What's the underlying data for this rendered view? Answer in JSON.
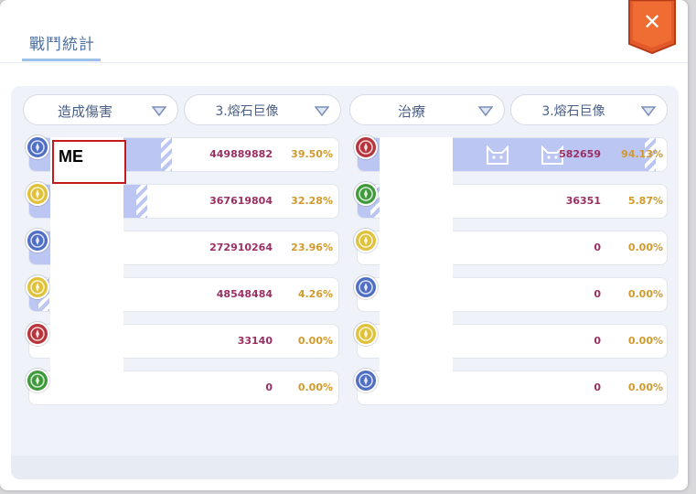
{
  "window": {
    "title": "戰鬥統計"
  },
  "close_button": {
    "symbol": "✕"
  },
  "left": {
    "metric_dropdown": "造成傷害",
    "target_dropdown": "3.熔石巨像",
    "rows": [
      {
        "color": "blue",
        "value": "449889882",
        "percent": "39.50%",
        "fraction": 0.395
      },
      {
        "color": "yellow",
        "value": "367619804",
        "percent": "32.28%",
        "fraction": 0.3228
      },
      {
        "color": "blue",
        "value": "272910264",
        "percent": "23.96%",
        "fraction": 0.2396
      },
      {
        "color": "yellow",
        "value": "48548484",
        "percent": "4.26%",
        "fraction": 0.0426
      },
      {
        "color": "red",
        "value": "33140",
        "percent": "0.00%",
        "fraction": 0
      },
      {
        "color": "green",
        "value": "0",
        "percent": "0.00%",
        "fraction": 0
      }
    ]
  },
  "right": {
    "metric_dropdown": "治療",
    "target_dropdown": "3.熔石巨像",
    "rows": [
      {
        "color": "red",
        "value": "582659",
        "percent": "94.13%",
        "fraction": 0.9413
      },
      {
        "color": "green",
        "value": "36351",
        "percent": "5.87%",
        "fraction": 0.0587
      },
      {
        "color": "yellow",
        "value": "0",
        "percent": "0.00%",
        "fraction": 0
      },
      {
        "color": "blue",
        "value": "0",
        "percent": "0.00%",
        "fraction": 0
      },
      {
        "color": "yellow",
        "value": "0",
        "percent": "0.00%",
        "fraction": 0
      },
      {
        "color": "blue",
        "value": "0",
        "percent": "0.00%",
        "fraction": 0
      }
    ]
  },
  "annotation": {
    "text": "ME"
  },
  "colors": {
    "blue": "#4f6fc4",
    "yellow": "#e0c23a",
    "red": "#b8343c",
    "green": "#3f9a3c",
    "accent": "#e85a2a"
  }
}
